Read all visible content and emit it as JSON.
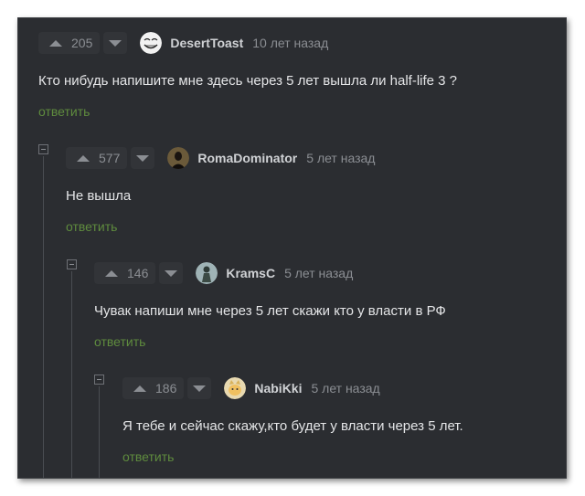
{
  "colors": {
    "background": "#2b2d31",
    "text": "#e4e5e7",
    "meta": "#8b8e93",
    "reply_link": "#5f8c3e"
  },
  "comments": [
    {
      "rating": "205",
      "username": "DesertToast",
      "time": "10 лет назад",
      "text": "Кто нибудь напишите мне здесь через 5 лет вышла ли half-life 3 ?",
      "reply_label": "ответить",
      "avatar_icon": "troll-face-icon"
    },
    {
      "rating": "577",
      "username": "RomaDominator",
      "time": "5 лет назад",
      "text": "Не вышла",
      "reply_label": "ответить",
      "avatar_icon": "dark-portrait-icon"
    },
    {
      "rating": "146",
      "username": "KramsC",
      "time": "5 лет назад",
      "text": "Чувак напиши мне через 5 лет скажи кто у власти в РФ",
      "reply_label": "ответить",
      "avatar_icon": "figure-portrait-icon"
    },
    {
      "rating": "186",
      "username": "NabiKki",
      "time": "5 лет назад",
      "text": "Я тебе и сейчас скажу,кто будет у власти через 5 лет.",
      "reply_label": "ответить",
      "avatar_icon": "cat-avatar-icon"
    }
  ]
}
